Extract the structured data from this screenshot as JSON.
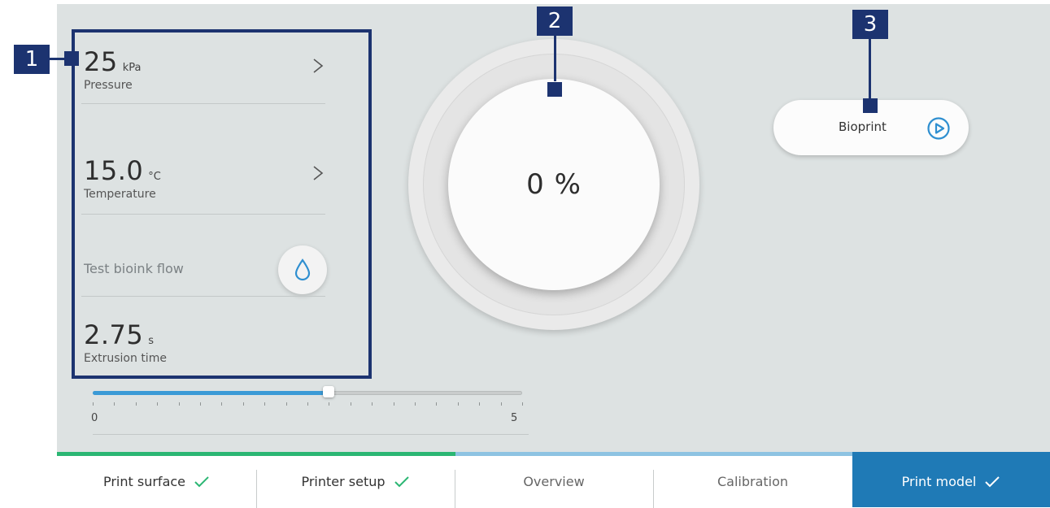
{
  "params": {
    "pressure": {
      "value": "25",
      "unit": "kPa",
      "label": "Pressure"
    },
    "temperature": {
      "value": "15.0",
      "unit": "°C",
      "label": "Temperature"
    },
    "flow": {
      "label": "Test bioink flow",
      "icon": "droplet-icon"
    },
    "extrusion": {
      "value": "2.75",
      "unit": "s",
      "label": "Extrusion time"
    }
  },
  "slider": {
    "min": "0",
    "max": "5",
    "value": 2.75
  },
  "progress": {
    "label": "0 %"
  },
  "bioprint": {
    "label": "Bioprint",
    "icon": "play-circle-icon"
  },
  "steps": [
    {
      "label": "Print surface",
      "done": true
    },
    {
      "label": "Printer setup",
      "done": true
    },
    {
      "label": "Overview",
      "done": false
    },
    {
      "label": "Calibration",
      "done": false
    },
    {
      "label": "Print model",
      "done": true,
      "active": true
    }
  ],
  "callouts": [
    "1",
    "2",
    "3"
  ],
  "colors": {
    "accent": "#1f7ab6",
    "check": "#2bb673",
    "slider_fill": "#3a9ad6",
    "annotation": "#1c3370",
    "panel_bg": "#dde2e2"
  }
}
